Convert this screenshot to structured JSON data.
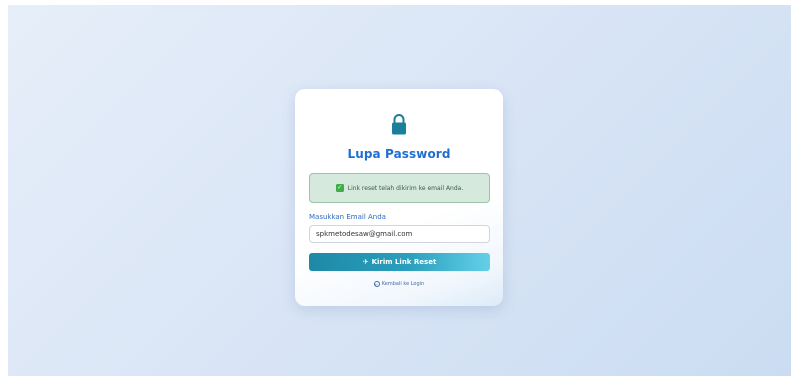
{
  "card": {
    "title": "Lupa Password",
    "lock_icon": "lock-icon"
  },
  "alert": {
    "icon": "check-icon",
    "message": "Link reset telah dikirim ke email Anda."
  },
  "form": {
    "email_label": "Masukkan Email Anda",
    "email_value": "spkmetodesaw@gmail.com",
    "submit_label": "Kirim Link Reset",
    "submit_icon": "send-icon"
  },
  "back_link": {
    "label": "Kembali ke Login",
    "icon": "back-arrow-icon"
  },
  "colors": {
    "accent": "#1f6fd0",
    "button": "#2a9fbd",
    "lock": "#1a7f9a",
    "success": "#3fae49"
  }
}
